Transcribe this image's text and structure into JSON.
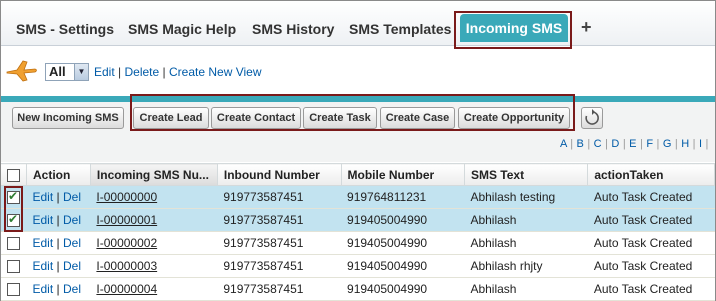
{
  "tabs": [
    "SMS - Settings",
    "SMS Magic Help",
    "SMS History",
    "SMS Templates"
  ],
  "active_tab": "Incoming SMS",
  "add_tab": "+",
  "view": {
    "selected": "All",
    "edit": "Edit",
    "delete": "Delete",
    "create_new_view": "Create New View",
    "sep": "|"
  },
  "buttons": {
    "new_incoming": "New Incoming SMS",
    "create_lead": "Create Lead",
    "create_contact": "Create Contact",
    "create_task": "Create Task",
    "create_case": "Create Case",
    "create_opportunity": "Create Opportunity"
  },
  "alphabet": [
    "A",
    "B",
    "C",
    "D",
    "E",
    "F",
    "G",
    "H",
    "I"
  ],
  "table": {
    "headers": [
      "Action",
      "Incoming SMS Nu...",
      "Inbound Number",
      "Mobile Number",
      "SMS Text",
      "actionTaken"
    ],
    "edit_label": "Edit",
    "del_label": "Del",
    "rows": [
      {
        "checked": true,
        "name": "I-00000000",
        "inbound": "919773587451",
        "mobile": "919764811231",
        "text": "Abhilash testing",
        "action": "Auto Task Created"
      },
      {
        "checked": true,
        "name": "I-00000001",
        "inbound": "919773587451",
        "mobile": "919405004990",
        "text": "Abhilash",
        "action": "Auto Task Created"
      },
      {
        "checked": false,
        "name": "I-00000002",
        "inbound": "919773587451",
        "mobile": "919405004990",
        "text": "Abhilash",
        "action": "Auto Task Created"
      },
      {
        "checked": false,
        "name": "I-00000003",
        "inbound": "919773587451",
        "mobile": "919405004990",
        "text": "Abhilash rhjty",
        "action": "Auto Task Created"
      },
      {
        "checked": false,
        "name": "I-00000004",
        "inbound": "919773587451",
        "mobile": "919405004990",
        "text": "Abhilash",
        "action": "Auto Task Created"
      }
    ]
  },
  "colors": {
    "accent": "#3aa9b9",
    "highlight_border": "#7a1a1a",
    "link": "#015ba7",
    "selected_row": "#c2e3f0"
  }
}
